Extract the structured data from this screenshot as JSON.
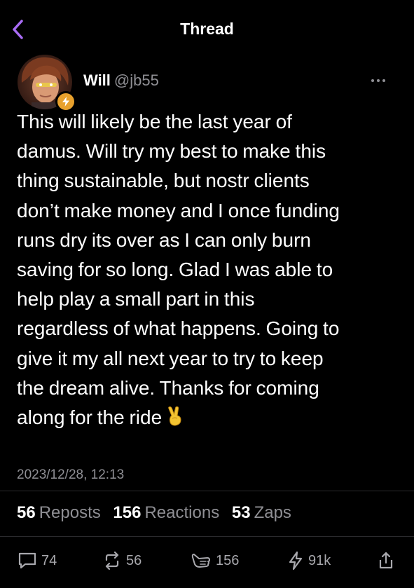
{
  "header": {
    "title": "Thread",
    "back_icon": "chevron-left-icon",
    "accent_color": "#a96cf5"
  },
  "post": {
    "author_name": "Will",
    "author_handle": "@jb55",
    "badge_icon": "lightning-icon",
    "badge_color": "#e8a12d",
    "text": "This will likely be the last year of\ndamus. Will try my best to make this\nthing sustainable, but nostr clients\ndon’t make money and I once funding\nruns dry its over as I can only burn\nsaving for so long. Glad I was able to\nhelp play a small part in this\nregardless of what happens. Going to\ngive it my all next year to try to keep\nthe dream alive. Thanks for coming\nalong for the ride",
    "emoji": "✌️",
    "timestamp": "2023/12/28, 12:13"
  },
  "stats": {
    "reposts_count": "56",
    "reposts_label": "Reposts",
    "reactions_count": "156",
    "reactions_label": "Reactions",
    "zaps_count": "53",
    "zaps_label": "Zaps"
  },
  "actions": {
    "reply_count": "74",
    "repost_count": "56",
    "like_count": "156",
    "zap_amount": "91k"
  }
}
